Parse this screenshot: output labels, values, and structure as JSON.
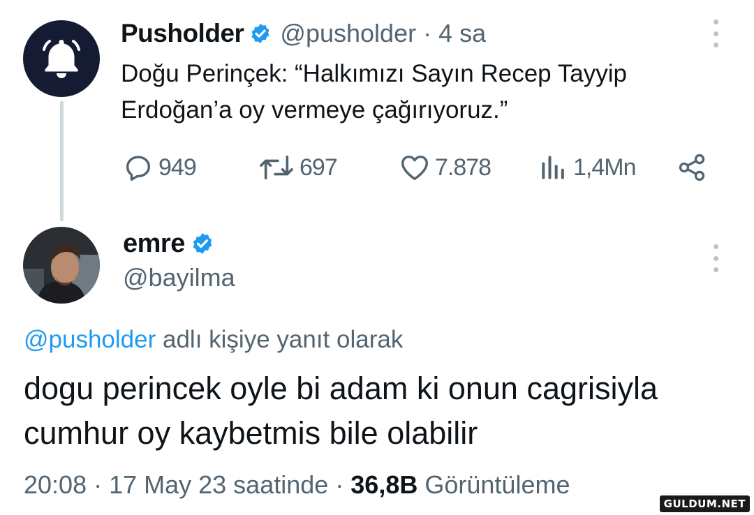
{
  "tweet1": {
    "author_name": "Pusholder",
    "handle_time": "@pusholder · 4 sa",
    "text": "Doğu Perinçek: “Halkımızı Sayın Recep Tayyip Erdoğan’a oy vermeye çağırıyoruz.”",
    "replies": "949",
    "retweets": "697",
    "likes": "7.878",
    "views": "1,4Mn",
    "avatar_icon": "bell-icon"
  },
  "tweet2": {
    "author_name": "emre",
    "handle": "@bayilma",
    "reply_mention": "@pusholder",
    "reply_suffix": " adlı kişiye yanıt olarak",
    "text": "dogu perincek oyle bi adam ki onun cagrisiyla cumhur oy kaybetmis bile olabilir",
    "meta_prefix": "20:08 · 17 May 23 saatinde · ",
    "views_count": "36,8B",
    "views_label": " Görüntüleme"
  },
  "watermark": "GULDUM.NET",
  "colors": {
    "verified_blue": "#1d9bf0",
    "secondary_text": "#536471",
    "primary_text": "#0f1419",
    "bell_avatar_bg": "#141b33"
  }
}
